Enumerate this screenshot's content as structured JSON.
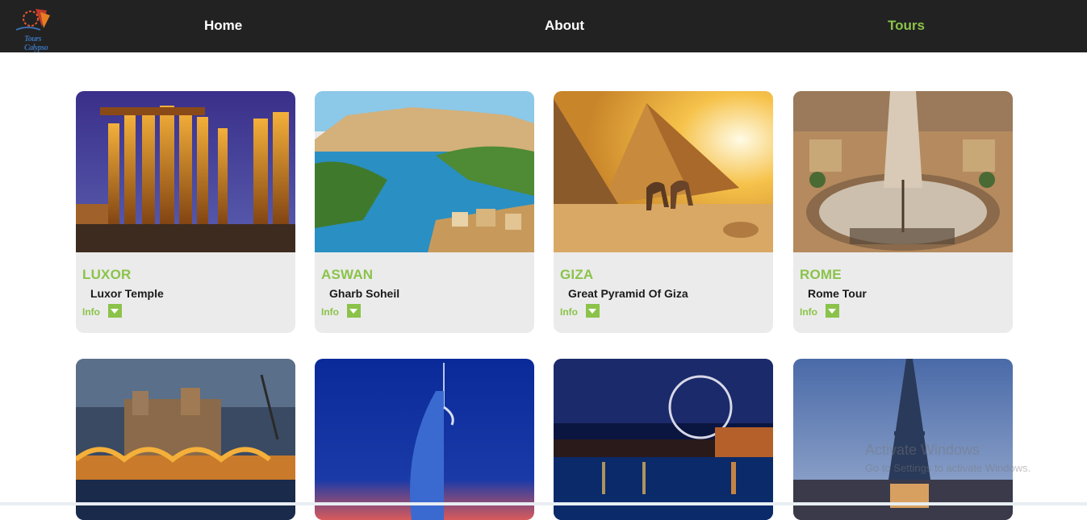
{
  "brand": {
    "logo_text": "Tours Calypso"
  },
  "nav": {
    "home": "Home",
    "about": "About",
    "tours": "Tours"
  },
  "cards": [
    {
      "city": "LUXOR",
      "tour": "Luxor Temple",
      "info": "Info"
    },
    {
      "city": "ASWAN",
      "tour": "Gharb Soheil",
      "info": "Info"
    },
    {
      "city": "GIZA",
      "tour": "Great Pyramid Of Giza",
      "info": "Info"
    },
    {
      "city": "ROME",
      "tour": "Rome Tour",
      "info": "Info"
    }
  ],
  "watermark": {
    "title": "Activate Windows",
    "subtitle": "Go to Settings to activate Windows."
  },
  "colors": {
    "accent": "#8bc34a",
    "nav_bg": "#222222",
    "card_bg": "#ebebeb"
  }
}
